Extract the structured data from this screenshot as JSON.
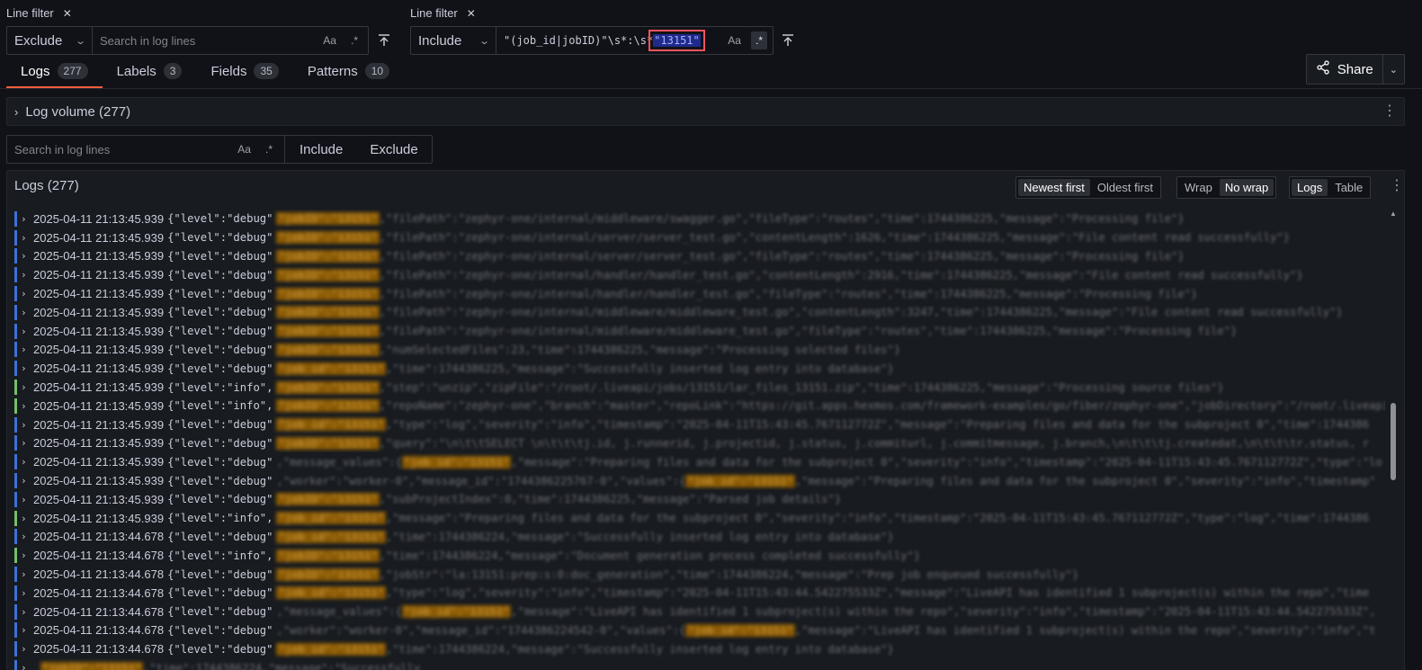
{
  "filters": [
    {
      "title": "Line filter",
      "mode": "Exclude",
      "placeholder": "Search in log lines",
      "query": "",
      "case_label": "Aa",
      "regex_label": ".*"
    },
    {
      "title": "Line filter",
      "mode": "Include",
      "query_prefix": "\"(job_id|jobID)\"\\s*:\\s*",
      "query_highlight": "\"13151\"",
      "case_label": "Aa",
      "regex_label": ".*"
    }
  ],
  "tabs": [
    {
      "label": "Logs",
      "count": "277"
    },
    {
      "label": "Labels",
      "count": "3"
    },
    {
      "label": "Fields",
      "count": "35"
    },
    {
      "label": "Patterns",
      "count": "10"
    }
  ],
  "share": {
    "label": "Share"
  },
  "log_volume": {
    "label": "Log volume (277)"
  },
  "search": {
    "placeholder": "Search in log lines",
    "case_label": "Aa",
    "regex_label": ".*",
    "include": "Include",
    "exclude": "Exclude"
  },
  "logs_panel": {
    "title": "Logs (277)",
    "sort": [
      "Newest first",
      "Oldest first"
    ],
    "wrap": [
      "Wrap",
      "No wrap"
    ],
    "view": [
      "Logs",
      "Table"
    ]
  },
  "colors": {
    "accent": "#f55f3e",
    "debug": "#3d71d9",
    "info": "#73bf69",
    "highlight": "#8a5a05"
  },
  "log_rows": [
    {
      "ts": "2025-04-11 21:13:45.939",
      "level": "{\"level\":\"debug\"",
      "type": "debug",
      "hl": "\"jobID\":\"13151\"",
      "rest": ",\"filePath\":\"zephyr-one/internal/middleware/swagger.go\",\"fileType\":\"routes\",\"time\":1744386225,\"message\":\"Processing file\"}"
    },
    {
      "ts": "2025-04-11 21:13:45.939",
      "level": "{\"level\":\"debug\"",
      "type": "debug",
      "hl": "\"jobID\":\"13151\"",
      "rest": ",\"filePath\":\"zephyr-one/internal/server/server_test.go\",\"contentLength\":1626,\"time\":1744386225,\"message\":\"File content read successfully\"}"
    },
    {
      "ts": "2025-04-11 21:13:45.939",
      "level": "{\"level\":\"debug\"",
      "type": "debug",
      "hl": "\"jobID\":\"13151\"",
      "rest": ",\"filePath\":\"zephyr-one/internal/server/server_test.go\",\"fileType\":\"routes\",\"time\":1744386225,\"message\":\"Processing file\"}"
    },
    {
      "ts": "2025-04-11 21:13:45.939",
      "level": "{\"level\":\"debug\"",
      "type": "debug",
      "hl": "\"jobID\":\"13151\"",
      "rest": ",\"filePath\":\"zephyr-one/internal/handler/handler_test.go\",\"contentLength\":2916,\"time\":1744386225,\"message\":\"File content read successfully\"}"
    },
    {
      "ts": "2025-04-11 21:13:45.939",
      "level": "{\"level\":\"debug\"",
      "type": "debug",
      "hl": "\"jobID\":\"13151\"",
      "rest": ",\"filePath\":\"zephyr-one/internal/handler/handler_test.go\",\"fileType\":\"routes\",\"time\":1744386225,\"message\":\"Processing file\"}"
    },
    {
      "ts": "2025-04-11 21:13:45.939",
      "level": "{\"level\":\"debug\"",
      "type": "debug",
      "hl": "\"jobID\":\"13151\"",
      "rest": ",\"filePath\":\"zephyr-one/internal/middleware/middleware_test.go\",\"contentLength\":3247,\"time\":1744386225,\"message\":\"File content read successfully\"}"
    },
    {
      "ts": "2025-04-11 21:13:45.939",
      "level": "{\"level\":\"debug\"",
      "type": "debug",
      "hl": "\"jobID\":\"13151\"",
      "rest": ",\"filePath\":\"zephyr-one/internal/middleware/middleware_test.go\",\"fileType\":\"routes\",\"time\":1744386225,\"message\":\"Processing file\"}"
    },
    {
      "ts": "2025-04-11 21:13:45.939",
      "level": "{\"level\":\"debug\"",
      "type": "debug",
      "hl": "\"jobID\":\"13151\"",
      "rest": ",\"numSelectedFiles\":23,\"time\":1744386225,\"message\":\"Processing selected files\"}"
    },
    {
      "ts": "2025-04-11 21:13:45.939",
      "level": "{\"level\":\"debug\"",
      "type": "debug",
      "hl": "\"job_id\":\"13151\"",
      "rest": ",\"time\":1744386225,\"message\":\"Successfully inserted log entry into database\"}"
    },
    {
      "ts": "2025-04-11 21:13:45.939",
      "level": "{\"level\":\"info\",",
      "type": "info",
      "hl": "\"jobID\":\"13151\"",
      "rest": ",\"step\":\"unzip\",\"zipFile\":\"/root/.liveapi/jobs/13151/lar_files_13151.zip\",\"time\":1744386225,\"message\":\"Processing source files\"}"
    },
    {
      "ts": "2025-04-11 21:13:45.939",
      "level": "{\"level\":\"info\",",
      "type": "info",
      "hl": "\"jobID\":\"13151\"",
      "rest": ",\"repoName\":\"zephyr-one\",\"branch\":\"master\",\"repoLink\":\"https://git.apps.hexmos.com/framework-examples/go/fiber/zephyr-one\",\"jobDirectory\":\"/root/.liveapi\""
    },
    {
      "ts": "2025-04-11 21:13:45.939",
      "level": "{\"level\":\"debug\"",
      "type": "debug",
      "hl": "\"job_id\":\"13151\"",
      "rest": ",\"type\":\"log\",\"severity\":\"info\",\"timestamp\":\"2025-04-11T15:43:45.767112772Z\",\"message\":\"Preparing files and data for the subproject 0\",\"time\":1744386"
    },
    {
      "ts": "2025-04-11 21:13:45.939",
      "level": "{\"level\":\"debug\"",
      "type": "debug",
      "hl": "\"jobID\":\"13151\"",
      "rest": ",\"query\":\"\\n\\t\\tSELECT \\n\\t\\t\\tj.id, j.runnerid, j.projectid, j.status, j.commiturl, j.commitmessage, j.branch,\\n\\t\\t\\tj.createdat,\\n\\t\\t\\tr.status, r"
    },
    {
      "ts": "2025-04-11 21:13:45.939",
      "level": "{\"level\":\"debug\"",
      "type": "debug",
      "pre": ",\"message_values\":{",
      "hl": "\"job_id\":\"13151\"",
      "rest": ",\"message\":\"Preparing files and data for the subproject 0\",\"severity\":\"info\",\"timestamp\":\"2025-04-11T15:43:45.767112772Z\",\"type\":\"lo"
    },
    {
      "ts": "2025-04-11 21:13:45.939",
      "level": "{\"level\":\"debug\"",
      "type": "debug",
      "pre": ",\"worker\":\"worker-0\",\"message_id\":\"1744386225767-0\",\"values\":{",
      "hl": "\"job_id\":\"13151\"",
      "rest": ",\"message\":\"Preparing files and data for the subproject 0\",\"severity\":\"info\",\"timestamp\""
    },
    {
      "ts": "2025-04-11 21:13:45.939",
      "level": "{\"level\":\"debug\"",
      "type": "debug",
      "hl": "\"jobID\":\"13151\"",
      "rest": ",\"subProjectIndex\":0,\"time\":1744386225,\"message\":\"Parsed job details\"}"
    },
    {
      "ts": "2025-04-11 21:13:45.939",
      "level": "{\"level\":\"info\",",
      "type": "info",
      "hl": "\"job_id\":\"13151\"",
      "rest": ",\"message\":\"Preparing files and data for the subproject 0\",\"severity\":\"info\",\"timestamp\":\"2025-04-11T15:43:45.767112772Z\",\"type\":\"log\",\"time\":1744386"
    },
    {
      "ts": "2025-04-11 21:13:44.678",
      "level": "{\"level\":\"debug\"",
      "type": "debug",
      "hl": "\"job_id\":\"13151\"",
      "rest": ",\"time\":1744386224,\"message\":\"Successfully inserted log entry into database\"}"
    },
    {
      "ts": "2025-04-11 21:13:44.678",
      "level": "{\"level\":\"info\",",
      "type": "info",
      "hl": "\"jobID\":\"13151\"",
      "rest": ",\"time\":1744386224,\"message\":\"Document generation process completed successfully\"}"
    },
    {
      "ts": "2025-04-11 21:13:44.678",
      "level": "{\"level\":\"debug\"",
      "type": "debug",
      "hl": "\"jobID\":\"13151\"",
      "rest": ",\"jobStr\":\"la:13151:prep:s:0:doc_generation\",\"time\":1744386224,\"message\":\"Prep job enqueued successfully\"}"
    },
    {
      "ts": "2025-04-11 21:13:44.678",
      "level": "{\"level\":\"debug\"",
      "type": "debug",
      "hl": "\"job_id\":\"13151\"",
      "rest": ",\"type\":\"log\",\"severity\":\"info\",\"timestamp\":\"2025-04-11T15:43:44.542275533Z\",\"message\":\"LiveAPI has identified 1 subproject(s) within the repo\",\"time"
    },
    {
      "ts": "2025-04-11 21:13:44.678",
      "level": "{\"level\":\"debug\"",
      "type": "debug",
      "pre": ",\"message_values\":{",
      "hl": "\"job_id\":\"13151\"",
      "rest": ",\"message\":\"LiveAPI has identified 1 subproject(s) within the repo\",\"severity\":\"info\",\"timestamp\":\"2025-04-11T15:43:44.542275533Z\","
    },
    {
      "ts": "2025-04-11 21:13:44.678",
      "level": "{\"level\":\"debug\"",
      "type": "debug",
      "pre": ",\"worker\":\"worker-0\",\"message_id\":\"1744386224542-0\",\"values\":{",
      "hl": "\"job_id\":\"13151\"",
      "rest": ",\"message\":\"LiveAPI has identified 1 subproject(s) within the repo\",\"severity\":\"info\",\"t"
    },
    {
      "ts": "2025-04-11 21:13:44.678",
      "level": "{\"level\":\"debug\"",
      "type": "debug",
      "hl": "\"job_id\":\"13151\"",
      "rest": ",\"time\":1744386224,\"message\":\"Successfully inserted log entry into database\"}"
    },
    {
      "ts": "",
      "level": "",
      "type": "debug",
      "hl": "\"jobID\":\"13151\"",
      "rest": ",\"time\":1744386224,\"message\":\"Successfully"
    }
  ]
}
